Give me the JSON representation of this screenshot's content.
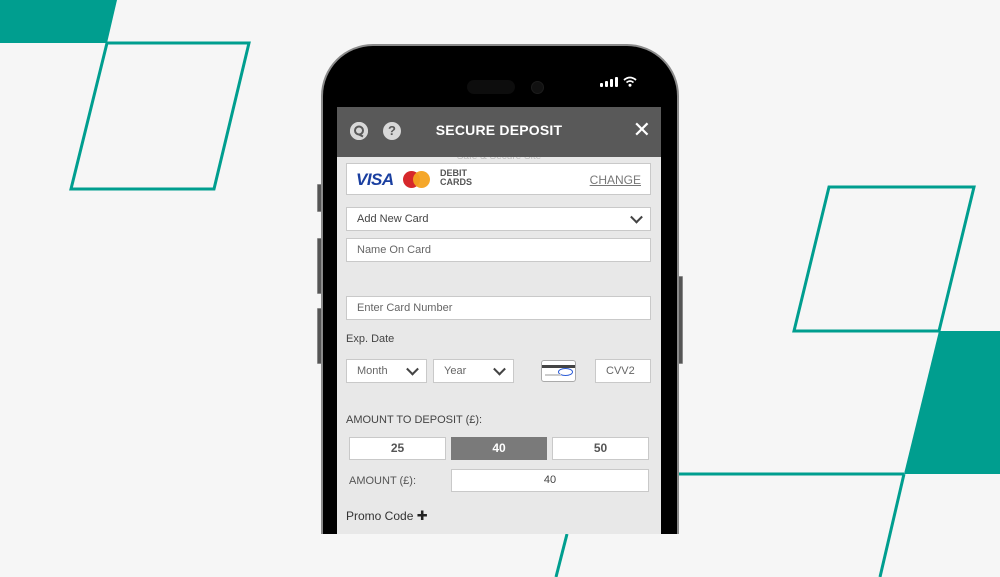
{
  "colors": {
    "accent": "#009e8f",
    "background": "#f6f6f6",
    "header": "#595959",
    "selected_amount": "#7a7a7a"
  },
  "status_bar": {
    "signal_icon": "signal-bars-icon",
    "wifi_icon": "wifi-icon"
  },
  "header": {
    "title": "SECURE DEPOSIT",
    "left_icons": [
      "live-chat-icon",
      "help-icon"
    ],
    "help_glyph": "?",
    "close_glyph": "✕",
    "subtitle": "Safe & Secure Site"
  },
  "payment_methods": {
    "visa": "VISA",
    "debit_line1": "DEBIT",
    "debit_line2": "CARDS",
    "change_link": "CHANGE"
  },
  "form": {
    "card_select": {
      "value": "Add New Card"
    },
    "name_on_card": {
      "placeholder": "Name On Card"
    },
    "card_number": {
      "placeholder": "Enter Card Number"
    },
    "exp_date_label": "Exp. Date",
    "month": {
      "value": "Month"
    },
    "year": {
      "value": "Year"
    },
    "cvv": {
      "placeholder": "CVV2"
    }
  },
  "deposit": {
    "label": "AMOUNT TO DEPOSIT (£):",
    "presets": [
      {
        "label": "25",
        "selected": false
      },
      {
        "label": "40",
        "selected": true
      },
      {
        "label": "50",
        "selected": false
      }
    ],
    "amount_label": "AMOUNT (£):",
    "amount_value": "40",
    "promo_label": "Promo Code",
    "promo_glyph": "✚"
  }
}
